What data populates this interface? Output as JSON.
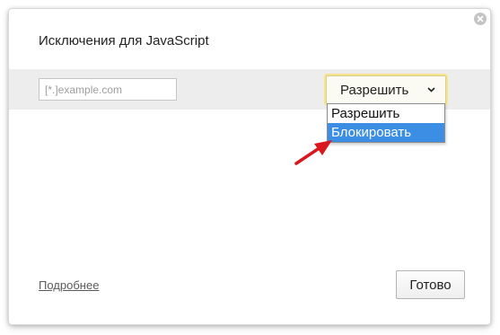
{
  "dialog": {
    "title": "Исключения для JavaScript",
    "close_icon": "close-icon"
  },
  "rule": {
    "pattern_placeholder": "[*.]example.com",
    "pattern_value": "",
    "action_selected": "Разрешить",
    "chevron_icon": "chevron-down-icon"
  },
  "dropdown": {
    "options": [
      {
        "label": "Разрешить",
        "highlighted": false
      },
      {
        "label": "Блокировать",
        "highlighted": true
      }
    ],
    "highlight_color": "#3b8ee4"
  },
  "annotation": {
    "arrow_icon": "red-arrow-icon",
    "arrow_color": "#d9181e"
  },
  "footer": {
    "more_link": "Подробнее",
    "done_label": "Готово"
  }
}
